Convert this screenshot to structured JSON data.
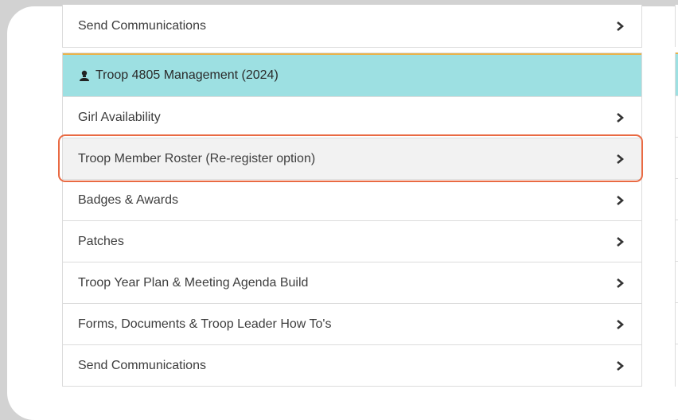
{
  "top_item": {
    "label": "Send Communications"
  },
  "section": {
    "title": "Troop 4805 Management (2024)",
    "items": [
      {
        "label": "Girl Availability"
      },
      {
        "label": "Troop Member Roster (Re-register option)"
      },
      {
        "label": "Badges & Awards"
      },
      {
        "label": "Patches"
      },
      {
        "label": "Troop Year Plan & Meeting Agenda Build"
      },
      {
        "label": "Forms, Documents & Troop Leader How To's"
      },
      {
        "label": "Send Communications"
      }
    ]
  },
  "colors": {
    "header_bg": "#9de0e2",
    "header_accent": "#e9b24a",
    "highlight": "#e96a43"
  },
  "icons": {
    "chevron": "chevron-right-icon",
    "person": "person-icon"
  }
}
